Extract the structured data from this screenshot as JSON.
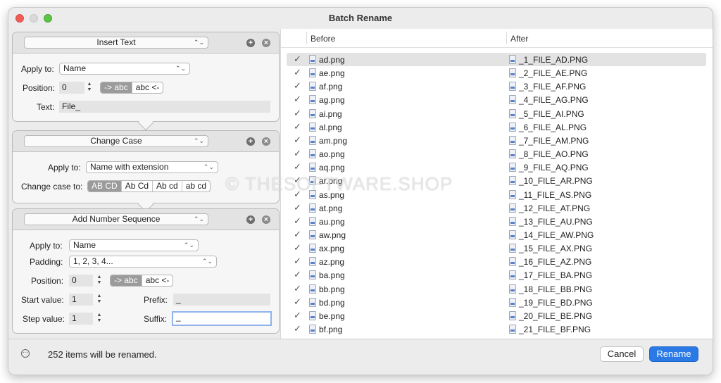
{
  "window": {
    "title": "Batch Rename"
  },
  "insert_text": {
    "header": "Insert Text",
    "apply_label": "Apply to:",
    "apply_value": "Name",
    "position_label": "Position:",
    "position_value": "0",
    "pos_options": [
      "-> abc",
      "abc <-"
    ],
    "text_label": "Text:",
    "text_value": "File_"
  },
  "change_case": {
    "header": "Change Case",
    "apply_label": "Apply to:",
    "apply_value": "Name with extension",
    "case_label": "Change case to:",
    "case_options": [
      "AB CD",
      "Ab Cd",
      "Ab cd",
      "ab cd"
    ]
  },
  "number_sequence": {
    "header": "Add Number Sequence",
    "apply_label": "Apply to:",
    "apply_value": "Name",
    "padding_label": "Padding:",
    "padding_value": "1, 2, 3, 4...",
    "position_label": "Position:",
    "position_value": "0",
    "pos_options": [
      "-> abc",
      "abc <-"
    ],
    "start_label": "Start value:",
    "start_value": "1",
    "step_label": "Step value:",
    "step_value": "1",
    "prefix_label": "Prefix:",
    "prefix_value": "_",
    "suffix_label": "Suffix:",
    "suffix_value": "_"
  },
  "table": {
    "col_before": "Before",
    "col_after": "After",
    "rows": [
      {
        "before": "ad.png",
        "after": "_1_FILE_AD.PNG"
      },
      {
        "before": "ae.png",
        "after": "_2_FILE_AE.PNG"
      },
      {
        "before": "af.png",
        "after": "_3_FILE_AF.PNG"
      },
      {
        "before": "ag.png",
        "after": "_4_FILE_AG.PNG"
      },
      {
        "before": "ai.png",
        "after": "_5_FILE_AI.PNG"
      },
      {
        "before": "al.png",
        "after": "_6_FILE_AL.PNG"
      },
      {
        "before": "am.png",
        "after": "_7_FILE_AM.PNG"
      },
      {
        "before": "ao.png",
        "after": "_8_FILE_AO.PNG"
      },
      {
        "before": "aq.png",
        "after": "_9_FILE_AQ.PNG"
      },
      {
        "before": "ar.png",
        "after": "_10_FILE_AR.PNG"
      },
      {
        "before": "as.png",
        "after": "_11_FILE_AS.PNG"
      },
      {
        "before": "at.png",
        "after": "_12_FILE_AT.PNG"
      },
      {
        "before": "au.png",
        "after": "_13_FILE_AU.PNG"
      },
      {
        "before": "aw.png",
        "after": "_14_FILE_AW.PNG"
      },
      {
        "before": "ax.png",
        "after": "_15_FILE_AX.PNG"
      },
      {
        "before": "az.png",
        "after": "_16_FILE_AZ.PNG"
      },
      {
        "before": "ba.png",
        "after": "_17_FILE_BA.PNG"
      },
      {
        "before": "bb.png",
        "after": "_18_FILE_BB.PNG"
      },
      {
        "before": "bd.png",
        "after": "_19_FILE_BD.PNG"
      },
      {
        "before": "be.png",
        "after": "_20_FILE_BE.PNG"
      },
      {
        "before": "bf.png",
        "after": "_21_FILE_BF.PNG"
      }
    ]
  },
  "footer": {
    "status": "252 items will be renamed.",
    "cancel": "Cancel",
    "rename": "Rename"
  },
  "watermark": "© THESOFTWARE.SHOP",
  "colors": {
    "accent": "#2a79e4",
    "selected_segment": "#9b9b9b"
  }
}
